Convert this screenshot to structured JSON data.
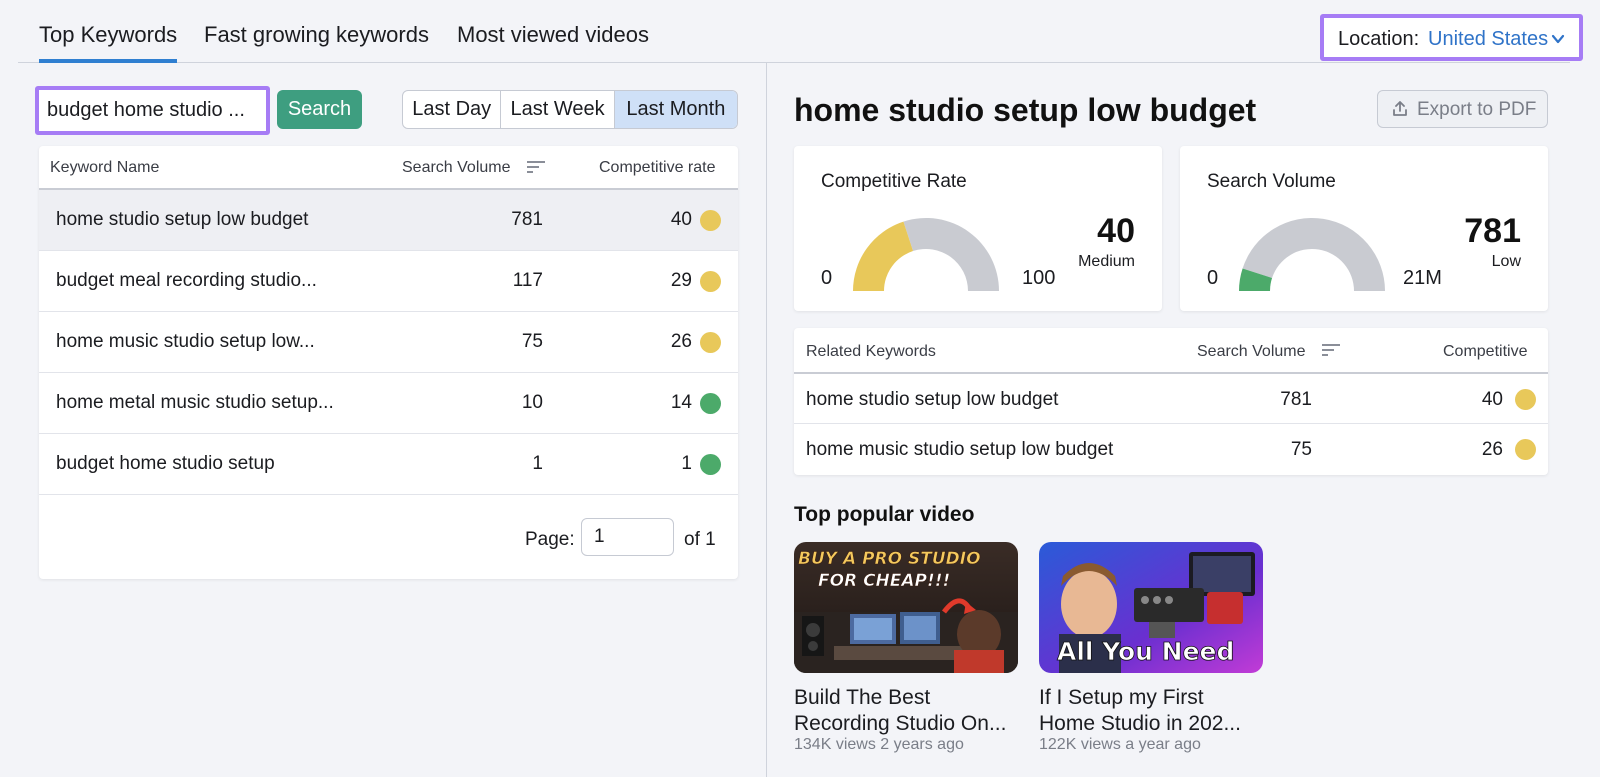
{
  "tabs": [
    {
      "label": "Top Keywords",
      "active": true
    },
    {
      "label": "Fast growing keywords",
      "active": false
    },
    {
      "label": "Most viewed videos",
      "active": false
    }
  ],
  "location": {
    "label": "Location:",
    "value": "United States",
    "icon": "chevron-down-icon"
  },
  "search": {
    "value": "budget home studio ...",
    "button_label": "Search"
  },
  "time_range": {
    "options": [
      "Last Day",
      "Last Week",
      "Last Month"
    ],
    "selected": "Last Month"
  },
  "keyword_table": {
    "columns": [
      "Keyword Name",
      "Search Volume",
      "Competitive rate"
    ],
    "rows": [
      {
        "keyword": "home studio setup low budget",
        "volume": "781",
        "rate": "40",
        "status_color": "#e8c85a"
      },
      {
        "keyword": "budget meal recording studio...",
        "volume": "117",
        "rate": "29",
        "status_color": "#e8c85a"
      },
      {
        "keyword": "home music studio setup low...",
        "volume": "75",
        "rate": "26",
        "status_color": "#e8c85a"
      },
      {
        "keyword": "home metal music studio setup...",
        "volume": "10",
        "rate": "14",
        "status_color": "#4caa6a"
      },
      {
        "keyword": "budget home studio setup",
        "volume": "1",
        "rate": "1",
        "status_color": "#4caa6a"
      }
    ],
    "pager": {
      "label": "Page:",
      "value": "1",
      "of_label": "of 1"
    }
  },
  "detail": {
    "title": "home studio setup low budget",
    "export_label": "Export to PDF",
    "competitive_rate": {
      "title": "Competitive Rate",
      "min": "0",
      "max": "100",
      "value": "40",
      "level": "Medium",
      "fill_fraction": 0.4,
      "fill_color": "#e8c85a"
    },
    "search_volume": {
      "title": "Search Volume",
      "min": "0",
      "max": "21M",
      "value": "781",
      "level": "Low",
      "fill_fraction": 0.1,
      "fill_color": "#4caa6a"
    },
    "related": {
      "columns": [
        "Related Keywords",
        "Search Volume",
        "Competitive"
      ],
      "rows": [
        {
          "keyword": "home studio setup low budget",
          "volume": "781",
          "rate": "40",
          "status_color": "#e8c85a"
        },
        {
          "keyword": "home music studio setup low budget",
          "volume": "75",
          "rate": "26",
          "status_color": "#e8c85a"
        }
      ]
    },
    "popular": {
      "title": "Top popular video",
      "videos": [
        {
          "title_line1": "Build The Best",
          "title_line2": "Recording Studio On...",
          "meta": "134K views 2 years ago",
          "thumb_text1": "BUY A PRO STUDIO",
          "thumb_text2": "FOR CHEAP!!!"
        },
        {
          "title_line1": "If I Setup my First",
          "title_line2": "Home Studio in 202...",
          "meta": "122K views a year ago",
          "thumb_text1": "All You Need"
        }
      ]
    }
  },
  "colors": {
    "accent": "#2f7fd1",
    "search_button": "#3e9e80",
    "highlight_border": "#a67cf5",
    "gauge_track": "#c9cbd1"
  }
}
